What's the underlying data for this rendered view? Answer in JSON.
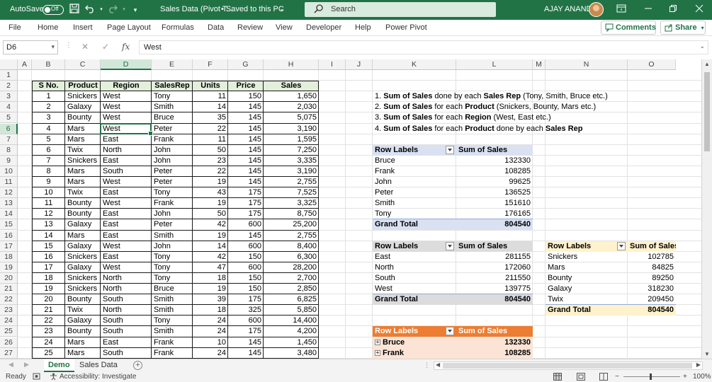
{
  "titlebar": {
    "autosave_label": "AutoSave",
    "autosave_state": "Off",
    "doc_title": "Sales Data (Pivot T...",
    "save_status": "• Saved to this PC",
    "search_placeholder": "Search",
    "user_name": "AJAY ANAND"
  },
  "menu": {
    "items": [
      "File",
      "Home",
      "Insert",
      "Page Layout",
      "Formulas",
      "Data",
      "Review",
      "View",
      "Developer",
      "Help",
      "Power Pivot"
    ],
    "comments_label": "Comments",
    "share_label": "Share"
  },
  "formula_bar": {
    "name_box": "D6",
    "formula": "West"
  },
  "columns": [
    "A",
    "B",
    "C",
    "D",
    "E",
    "F",
    "G",
    "H",
    "I",
    "J",
    "K",
    "L",
    "M",
    "N",
    "O"
  ],
  "rows": [
    1,
    2,
    3,
    4,
    5,
    6,
    7,
    8,
    9,
    10,
    11,
    12,
    13,
    14,
    15,
    16,
    17,
    18,
    19,
    20,
    21,
    22,
    23,
    24,
    25,
    26,
    27
  ],
  "selected_cell": "D6",
  "sales_table": {
    "headers": [
      "S No.",
      "Product",
      "Region",
      "SalesRep",
      "Units",
      "Price",
      "Sales"
    ],
    "rows": [
      [
        "1",
        "Snickers",
        "West",
        "Tony",
        "11",
        "150",
        "1,650"
      ],
      [
        "2",
        "Galaxy",
        "West",
        "Smith",
        "14",
        "145",
        "2,030"
      ],
      [
        "3",
        "Bounty",
        "West",
        "Bruce",
        "35",
        "145",
        "5,075"
      ],
      [
        "4",
        "Mars",
        "West",
        "Peter",
        "22",
        "145",
        "3,190"
      ],
      [
        "5",
        "Mars",
        "East",
        "Frank",
        "11",
        "145",
        "1,595"
      ],
      [
        "6",
        "Twix",
        "North",
        "John",
        "50",
        "145",
        "7,250"
      ],
      [
        "7",
        "Snickers",
        "East",
        "John",
        "23",
        "145",
        "3,335"
      ],
      [
        "8",
        "Mars",
        "South",
        "Peter",
        "22",
        "145",
        "3,190"
      ],
      [
        "9",
        "Mars",
        "West",
        "Peter",
        "19",
        "145",
        "2,755"
      ],
      [
        "10",
        "Twix",
        "East",
        "Tony",
        "43",
        "175",
        "7,525"
      ],
      [
        "11",
        "Bounty",
        "West",
        "Frank",
        "19",
        "175",
        "3,325"
      ],
      [
        "12",
        "Bounty",
        "East",
        "John",
        "50",
        "175",
        "8,750"
      ],
      [
        "13",
        "Galaxy",
        "East",
        "Peter",
        "42",
        "600",
        "25,200"
      ],
      [
        "14",
        "Mars",
        "East",
        "Smith",
        "19",
        "145",
        "2,755"
      ],
      [
        "15",
        "Galaxy",
        "West",
        "John",
        "14",
        "600",
        "8,400"
      ],
      [
        "16",
        "Snickers",
        "East",
        "Tony",
        "42",
        "150",
        "6,300"
      ],
      [
        "17",
        "Galaxy",
        "West",
        "Tony",
        "47",
        "600",
        "28,200"
      ],
      [
        "18",
        "Snickers",
        "North",
        "Tony",
        "18",
        "150",
        "2,700"
      ],
      [
        "19",
        "Snickers",
        "North",
        "Bruce",
        "19",
        "150",
        "2,850"
      ],
      [
        "20",
        "Bounty",
        "South",
        "Smith",
        "39",
        "175",
        "6,825"
      ],
      [
        "21",
        "Twix",
        "North",
        "Smith",
        "18",
        "325",
        "5,850"
      ],
      [
        "22",
        "Galaxy",
        "South",
        "Tony",
        "24",
        "600",
        "14,400"
      ],
      [
        "23",
        "Bounty",
        "South",
        "Smith",
        "24",
        "175",
        "4,200"
      ],
      [
        "24",
        "Mars",
        "East",
        "Frank",
        "10",
        "145",
        "1,450"
      ],
      [
        "25",
        "Mars",
        "South",
        "Frank",
        "24",
        "145",
        "3,480"
      ]
    ]
  },
  "notes": [
    {
      "num": "1.",
      "parts": [
        [
          "b",
          "Sum of Sales"
        ],
        [
          "n",
          " done by each "
        ],
        [
          "b",
          "Sales Rep"
        ],
        [
          "n",
          " (Tony, Smith, Bruce etc.)"
        ]
      ]
    },
    {
      "num": "2.",
      "parts": [
        [
          "b",
          "Sum of Sales"
        ],
        [
          "n",
          " for each "
        ],
        [
          "b",
          "Product"
        ],
        [
          "n",
          " (Snickers, Bounty, Mars etc.)"
        ]
      ]
    },
    {
      "num": "3.",
      "parts": [
        [
          "b",
          "Sum of Sales"
        ],
        [
          "n",
          " for each "
        ],
        [
          "b",
          "Region"
        ],
        [
          "n",
          " (West, East etc.)"
        ]
      ]
    },
    {
      "num": "4.",
      "parts": [
        [
          "b",
          "Sum of Sales"
        ],
        [
          "n",
          " for each "
        ],
        [
          "b",
          "Product"
        ],
        [
          "n",
          " done by each "
        ],
        [
          "b",
          "Sales Rep"
        ]
      ]
    }
  ],
  "pivot_salesrep": {
    "header_label": "Row Labels",
    "header_value": "Sum of Sales",
    "rows": [
      [
        "Bruce",
        "132330"
      ],
      [
        "Frank",
        "108285"
      ],
      [
        "John",
        "99625"
      ],
      [
        "Peter",
        "136525"
      ],
      [
        "Smith",
        "151610"
      ],
      [
        "Tony",
        "176165"
      ]
    ],
    "total_label": "Grand Total",
    "total_value": "804540",
    "accent": "#d9e1f2"
  },
  "pivot_region": {
    "header_label": "Row Labels",
    "header_value": "Sum of Sales",
    "rows": [
      [
        "East",
        "281155"
      ],
      [
        "North",
        "172060"
      ],
      [
        "South",
        "211550"
      ],
      [
        "West",
        "139775"
      ]
    ],
    "total_label": "Grand Total",
    "total_value": "804540",
    "accent": "#dcdcdc"
  },
  "pivot_product": {
    "header_label": "Row Labels",
    "header_value": "Sum of Sales",
    "rows": [
      [
        "Snickers",
        "102785"
      ],
      [
        "Mars",
        "84825"
      ],
      [
        "Bounty",
        "89250"
      ],
      [
        "Galaxy",
        "318230"
      ],
      [
        "Twix",
        "209450"
      ]
    ],
    "total_label": "Grand Total",
    "total_value": "804540",
    "accent": "#fff2cc"
  },
  "pivot_product_rep": {
    "header_label": "Row Labels",
    "header_value": "Sum of Sales",
    "rows": [
      [
        "Bruce",
        "132330"
      ],
      [
        "Frank",
        "108285"
      ]
    ],
    "accent": "#ed7d31",
    "row_fill": "#fbe4d5"
  },
  "sheets": {
    "tabs": [
      "Demo",
      "Sales Data"
    ],
    "active": "Demo"
  },
  "status": {
    "ready": "Ready",
    "accessibility": "Accessibility: Investigate",
    "zoom": "100%"
  },
  "colors": {
    "excel_green": "#217346",
    "selection_green": "#d2e7d9"
  }
}
